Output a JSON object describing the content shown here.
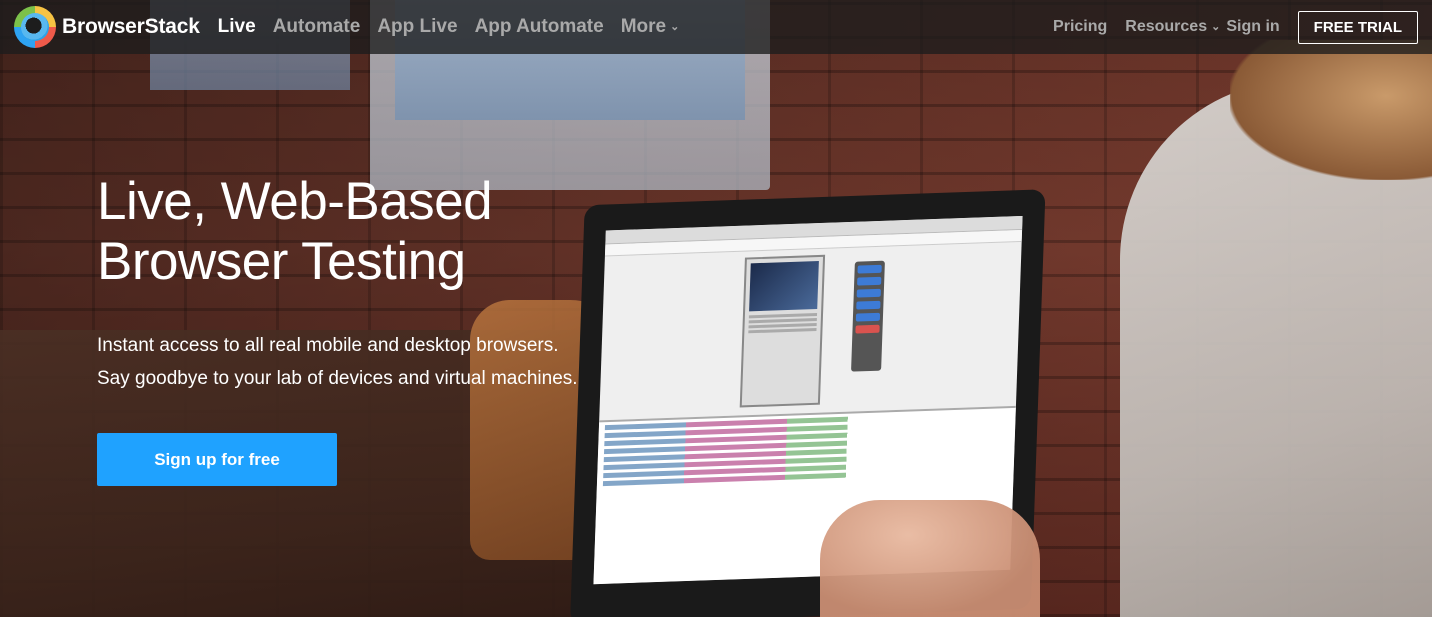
{
  "brand": {
    "name": "BrowserStack",
    "logo_icon": "browserstack-logo-icon"
  },
  "nav": {
    "items": [
      {
        "label": "Live",
        "active": true
      },
      {
        "label": "Automate",
        "active": false
      },
      {
        "label": "App Live",
        "active": false
      },
      {
        "label": "App Automate",
        "active": false
      },
      {
        "label": "More",
        "active": false,
        "dropdown": true
      }
    ],
    "right": {
      "pricing": "Pricing",
      "resources": "Resources",
      "signin": "Sign in",
      "trial": "FREE TRIAL"
    }
  },
  "hero": {
    "title_line1": "Live, Web-Based",
    "title_line2": "Browser Testing",
    "subtitle_line1": "Instant access to all real mobile and desktop browsers.",
    "subtitle_line2": "Say goodbye to your lab of devices and virtual machines.",
    "cta": "Sign up for free"
  },
  "colors": {
    "cta": "#1fa2ff",
    "nav_bg": "#1c1c1c",
    "nav_inactive": "#a9a9a9"
  }
}
